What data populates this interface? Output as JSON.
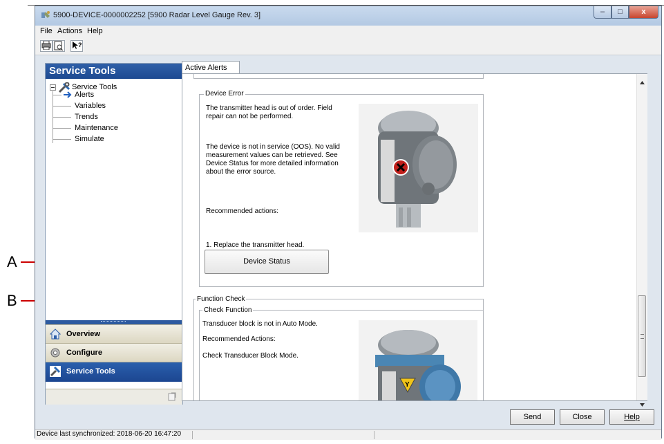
{
  "window": {
    "title": "5900-DEVICE-0000002252 [5900 Radar Level Gauge Rev. 3]",
    "minimize_glyph": "–",
    "maximize_glyph": "□",
    "close_glyph": "x"
  },
  "menu": {
    "items": [
      "File",
      "Actions",
      "Help"
    ]
  },
  "toolbar": {
    "icons": [
      "print-icon",
      "print-preview-icon",
      "context-help-icon"
    ]
  },
  "left_panel": {
    "header": "Service Tools",
    "tree": {
      "root": "Service Tools",
      "children": [
        "Alerts",
        "Variables",
        "Trends",
        "Maintenance",
        "Simulate"
      ],
      "selected": "Alerts"
    },
    "nav": [
      {
        "label": "Overview",
        "icon": "overview-icon"
      },
      {
        "label": "Configure",
        "icon": "configure-icon"
      },
      {
        "label": "Service Tools",
        "icon": "service-tools-icon",
        "selected": true
      }
    ]
  },
  "tabs": [
    "Active Alerts"
  ],
  "alerts": {
    "device_error": {
      "legend": "Device Error",
      "p1": "The transmitter head is out of order. Field repair can not be performed.",
      "p2": "The device is not in service (OOS). No valid measurement values can be retrieved. See Device Status for more detailed information about the error source.",
      "p3": "Recommended actions:",
      "p4": "1. Replace the transmitter head.",
      "button": "Device Status"
    },
    "function_check": {
      "legend": "Function Check",
      "sub_legend": "Check Function",
      "p1": "Transducer block is not in Auto Mode.",
      "p2": "Recommended Actions:",
      "p3": "Check Transducer Block Mode."
    }
  },
  "buttons": {
    "send": "Send",
    "close": "Close",
    "help": "Help"
  },
  "status": {
    "text": "Device last synchronized: 2018-06-20 16:47:20"
  },
  "callouts": {
    "a": "A",
    "b": "B"
  },
  "colors": {
    "header_blue": "#1d4a91",
    "callout_red": "#cc0000",
    "error_red": "#c0201b",
    "warning_yellow": "#f0c419",
    "housing_blue": "#4a86b4"
  }
}
